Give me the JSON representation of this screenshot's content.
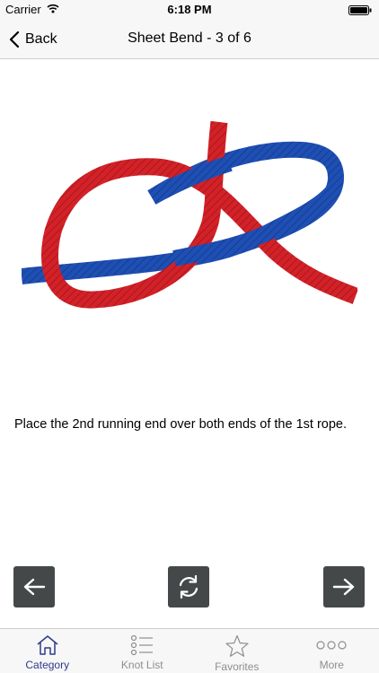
{
  "status_bar": {
    "carrier": "Carrier",
    "time": "6:18 PM",
    "icons": [
      "wifi-icon",
      "battery-icon"
    ]
  },
  "nav": {
    "back_label": "Back",
    "title": "Sheet Bend - 3 of 6"
  },
  "content": {
    "instruction": "Place the 2nd running end over both ends of the 1st rope.",
    "rope_colors": {
      "red": "#d42128",
      "blue": "#1e4fb5"
    }
  },
  "controls": {
    "icons": [
      "arrow-left-icon",
      "refresh-icon",
      "arrow-right-icon"
    ],
    "button_color": "#444849"
  },
  "tab_bar": {
    "active_color": "#2f3a8c",
    "inactive_color": "#8e8e93",
    "tabs": [
      {
        "label": "Category",
        "icon": "house-icon",
        "active": true
      },
      {
        "label": "Knot List",
        "icon": "list-icon",
        "active": false
      },
      {
        "label": "Favorites",
        "icon": "star-icon",
        "active": false
      },
      {
        "label": "More",
        "icon": "more-icon",
        "active": false
      }
    ]
  }
}
